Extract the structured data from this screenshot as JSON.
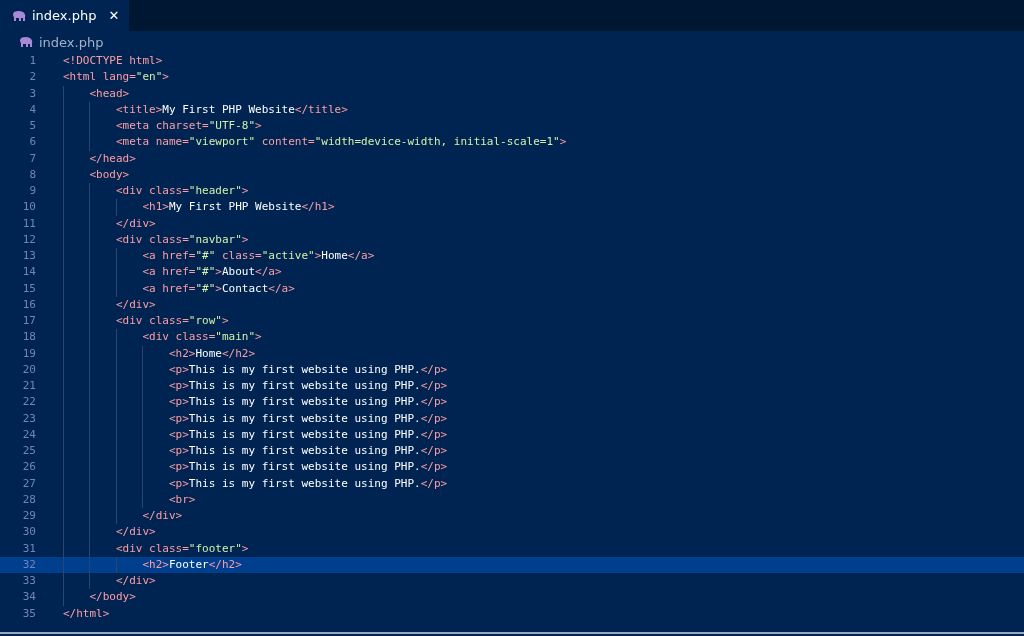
{
  "tabs": [
    {
      "label": "index.php",
      "selected": true,
      "close": "✕"
    }
  ],
  "breadcrumb": "index.php",
  "editor": {
    "lines": [
      {
        "n": "1",
        "selected": false,
        "code": [
          {
            "kind": "tag",
            "t": "<!DOCTYPE html>"
          }
        ]
      },
      {
        "n": "2",
        "selected": false,
        "code": [
          {
            "kind": "tag",
            "t": "<html lang="
          },
          {
            "kind": "str",
            "t": "\"en\""
          },
          {
            "kind": "tag",
            "t": ">"
          }
        ]
      },
      {
        "n": "3",
        "selected": false,
        "code": [
          {
            "kind": "tag",
            "t": "    <head>"
          }
        ]
      },
      {
        "n": "4",
        "selected": false,
        "code": [
          {
            "kind": "tag",
            "t": "        <title>"
          },
          {
            "kind": "txt",
            "t": "My First PHP Website"
          },
          {
            "kind": "tag",
            "t": "</title>"
          }
        ]
      },
      {
        "n": "5",
        "selected": false,
        "code": [
          {
            "kind": "tag",
            "t": "        <meta charset="
          },
          {
            "kind": "str",
            "t": "\"UTF-8\""
          },
          {
            "kind": "tag",
            "t": ">"
          }
        ]
      },
      {
        "n": "6",
        "selected": false,
        "code": [
          {
            "kind": "tag",
            "t": "        <meta name="
          },
          {
            "kind": "str",
            "t": "\"viewport\""
          },
          {
            "kind": "tag",
            "t": " content="
          },
          {
            "kind": "str",
            "t": "\"width=device-width, initial-scale=1\""
          },
          {
            "kind": "tag",
            "t": ">"
          }
        ]
      },
      {
        "n": "7",
        "selected": false,
        "code": [
          {
            "kind": "tag",
            "t": "    </head>"
          }
        ]
      },
      {
        "n": "8",
        "selected": false,
        "code": [
          {
            "kind": "tag",
            "t": "    <body>"
          }
        ]
      },
      {
        "n": "9",
        "selected": false,
        "code": [
          {
            "kind": "tag",
            "t": "        <div class="
          },
          {
            "kind": "str",
            "t": "\"header\""
          },
          {
            "kind": "tag",
            "t": ">"
          }
        ]
      },
      {
        "n": "10",
        "selected": false,
        "code": [
          {
            "kind": "tag",
            "t": "            <h1>"
          },
          {
            "kind": "txt",
            "t": "My First PHP Website"
          },
          {
            "kind": "tag",
            "t": "</h1>"
          }
        ]
      },
      {
        "n": "11",
        "selected": false,
        "code": [
          {
            "kind": "tag",
            "t": "        </div>"
          }
        ]
      },
      {
        "n": "12",
        "selected": false,
        "code": [
          {
            "kind": "tag",
            "t": "        <div class="
          },
          {
            "kind": "str",
            "t": "\"navbar\""
          },
          {
            "kind": "tag",
            "t": ">"
          }
        ]
      },
      {
        "n": "13",
        "selected": false,
        "code": [
          {
            "kind": "tag",
            "t": "            <a href="
          },
          {
            "kind": "str",
            "t": "\"#\""
          },
          {
            "kind": "tag",
            "t": " class="
          },
          {
            "kind": "str",
            "t": "\"active\""
          },
          {
            "kind": "tag",
            "t": ">"
          },
          {
            "kind": "txt",
            "t": "Home"
          },
          {
            "kind": "tag",
            "t": "</a>"
          }
        ]
      },
      {
        "n": "14",
        "selected": false,
        "code": [
          {
            "kind": "tag",
            "t": "            <a href="
          },
          {
            "kind": "str",
            "t": "\"#\""
          },
          {
            "kind": "tag",
            "t": ">"
          },
          {
            "kind": "txt",
            "t": "About"
          },
          {
            "kind": "tag",
            "t": "</a>"
          }
        ]
      },
      {
        "n": "15",
        "selected": false,
        "code": [
          {
            "kind": "tag",
            "t": "            <a href="
          },
          {
            "kind": "str",
            "t": "\"#\""
          },
          {
            "kind": "tag",
            "t": ">"
          },
          {
            "kind": "txt",
            "t": "Contact"
          },
          {
            "kind": "tag",
            "t": "</a>"
          }
        ]
      },
      {
        "n": "16",
        "selected": false,
        "code": [
          {
            "kind": "tag",
            "t": "        </div>"
          }
        ]
      },
      {
        "n": "17",
        "selected": false,
        "code": [
          {
            "kind": "tag",
            "t": "        <div class="
          },
          {
            "kind": "str",
            "t": "\"row\""
          },
          {
            "kind": "tag",
            "t": ">"
          }
        ]
      },
      {
        "n": "18",
        "selected": false,
        "code": [
          {
            "kind": "tag",
            "t": "            <div class="
          },
          {
            "kind": "str",
            "t": "\"main\""
          },
          {
            "kind": "tag",
            "t": ">"
          }
        ]
      },
      {
        "n": "19",
        "selected": false,
        "code": [
          {
            "kind": "tag",
            "t": "                <h2>"
          },
          {
            "kind": "txt",
            "t": "Home"
          },
          {
            "kind": "tag",
            "t": "</h2>"
          }
        ]
      },
      {
        "n": "20",
        "selected": false,
        "code": [
          {
            "kind": "tag",
            "t": "                <p>"
          },
          {
            "kind": "txt",
            "t": "This is my first website using PHP."
          },
          {
            "kind": "tag",
            "t": "</p>"
          }
        ]
      },
      {
        "n": "21",
        "selected": false,
        "code": [
          {
            "kind": "tag",
            "t": "                <p>"
          },
          {
            "kind": "txt",
            "t": "This is my first website using PHP."
          },
          {
            "kind": "tag",
            "t": "</p>"
          }
        ]
      },
      {
        "n": "22",
        "selected": false,
        "code": [
          {
            "kind": "tag",
            "t": "                <p>"
          },
          {
            "kind": "txt",
            "t": "This is my first website using PHP."
          },
          {
            "kind": "tag",
            "t": "</p>"
          }
        ]
      },
      {
        "n": "23",
        "selected": false,
        "code": [
          {
            "kind": "tag",
            "t": "                <p>"
          },
          {
            "kind": "txt",
            "t": "This is my first website using PHP."
          },
          {
            "kind": "tag",
            "t": "</p>"
          }
        ]
      },
      {
        "n": "24",
        "selected": false,
        "code": [
          {
            "kind": "tag",
            "t": "                <p>"
          },
          {
            "kind": "txt",
            "t": "This is my first website using PHP."
          },
          {
            "kind": "tag",
            "t": "</p>"
          }
        ]
      },
      {
        "n": "25",
        "selected": false,
        "code": [
          {
            "kind": "tag",
            "t": "                <p>"
          },
          {
            "kind": "txt",
            "t": "This is my first website using PHP."
          },
          {
            "kind": "tag",
            "t": "</p>"
          }
        ]
      },
      {
        "n": "26",
        "selected": false,
        "code": [
          {
            "kind": "tag",
            "t": "                <p>"
          },
          {
            "kind": "txt",
            "t": "This is my first website using PHP."
          },
          {
            "kind": "tag",
            "t": "</p>"
          }
        ]
      },
      {
        "n": "27",
        "selected": false,
        "code": [
          {
            "kind": "tag",
            "t": "                <p>"
          },
          {
            "kind": "txt",
            "t": "This is my first website using PHP."
          },
          {
            "kind": "tag",
            "t": "</p>"
          }
        ]
      },
      {
        "n": "28",
        "selected": false,
        "code": [
          {
            "kind": "tag",
            "t": "                <br>"
          }
        ]
      },
      {
        "n": "29",
        "selected": false,
        "code": [
          {
            "kind": "tag",
            "t": "            </div>"
          }
        ]
      },
      {
        "n": "30",
        "selected": false,
        "code": [
          {
            "kind": "tag",
            "t": "        </div>"
          }
        ]
      },
      {
        "n": "31",
        "selected": false,
        "code": [
          {
            "kind": "tag",
            "t": "        <div class="
          },
          {
            "kind": "str",
            "t": "\"footer\""
          },
          {
            "kind": "tag",
            "t": ">"
          }
        ]
      },
      {
        "n": "32",
        "selected": true,
        "code": [
          {
            "kind": "tag",
            "t": "            <h2>"
          },
          {
            "kind": "txt",
            "t": "Footer"
          },
          {
            "kind": "tag",
            "t": "</h2>"
          }
        ]
      },
      {
        "n": "33",
        "selected": false,
        "code": [
          {
            "kind": "tag",
            "t": "        </div>"
          }
        ]
      },
      {
        "n": "34",
        "selected": false,
        "code": [
          {
            "kind": "tag",
            "t": "    </body>"
          }
        ]
      },
      {
        "n": "35",
        "selected": false,
        "code": [
          {
            "kind": "tag",
            "t": "</html>"
          }
        ]
      }
    ]
  }
}
